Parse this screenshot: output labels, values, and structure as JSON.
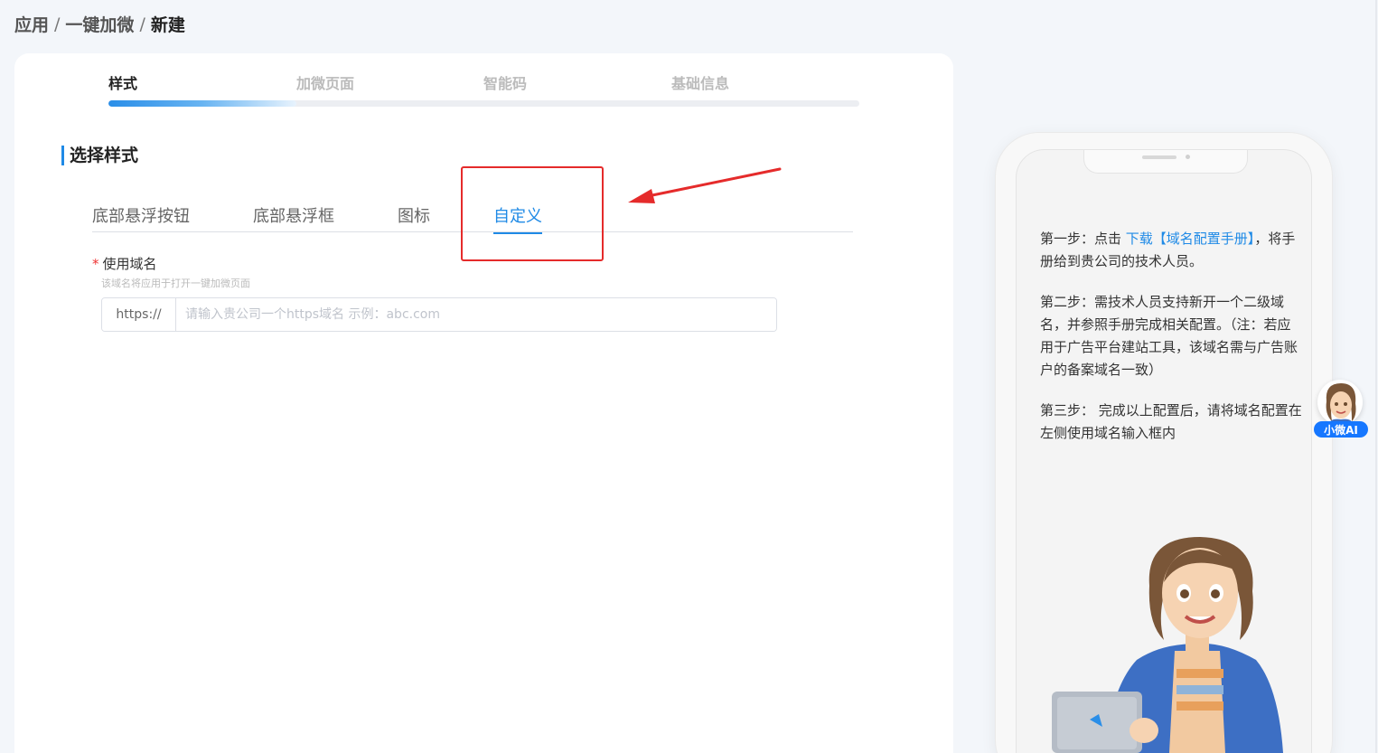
{
  "breadcrumb": {
    "items": [
      "应用",
      "一键加微",
      "新建"
    ],
    "separator": "/"
  },
  "steps": {
    "items": [
      "样式",
      "加微页面",
      "智能码",
      "基础信息"
    ],
    "active_index": 0,
    "progress": 0.25
  },
  "section": {
    "title": "选择样式"
  },
  "style_tabs": {
    "items": [
      "底部悬浮按钮",
      "底部悬浮框",
      "图标",
      "自定义"
    ],
    "active_index": 3
  },
  "domain_field": {
    "label": "使用域名",
    "required_mark": "*",
    "hint": "该域名将应用于打开一键加微页面",
    "prefix": "https://",
    "value": "",
    "placeholder": "请输入贵公司一个https域名 示例：abc.com"
  },
  "instructions": {
    "step1_prefix": "第一步：点击 ",
    "step1_link1": "下载",
    "step1_link2": "【域名配置手册】",
    "step1_suffix": "，将手册给到贵公司的技术人员。",
    "step2": "第二步：需技术人员支持新开一个二级域名，并参照手册完成相关配置。",
    "step2_note": "（注：若应用于广告平台建站工具，该域名需与广告账户的备案域名一致）",
    "step3": "第三步： 完成以上配置后，请将域名配置在左侧使用域名输入框内"
  },
  "ai_assistant": {
    "label": "小微AI"
  },
  "colors": {
    "accent": "#1f8ae6",
    "annotation_red": "#e52b2b",
    "ai_blue": "#1677ff"
  },
  "icons": [
    "arrow-annotation-icon",
    "assistant-avatar-icon"
  ]
}
